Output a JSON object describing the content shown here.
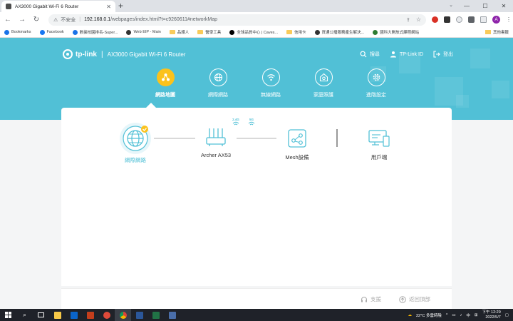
{
  "browser": {
    "tab_title": "AX3000 Gigabit Wi-Fi 6 Router",
    "address_insecure": "不安全",
    "address_host": "192.168.0.1",
    "address_path": "/webpages/index.html?t=c9260611#networkMap",
    "avatar_letter": "A",
    "bookmarks": [
      {
        "label": "Bookmarks",
        "icon": "star-icon",
        "color": "#1a73e8"
      },
      {
        "label": "Facebook",
        "icon": "facebook-icon",
        "color": "#1877f2"
      },
      {
        "label": "數據校園排名-Super...",
        "icon": "globe-icon",
        "color": "#1a73e8"
      },
      {
        "label": "Web EIP - Main",
        "icon": "globe-icon",
        "color": "#333333"
      },
      {
        "label": "品護人",
        "icon": "folder-icon",
        "color": "#f9cb5b"
      },
      {
        "label": "醫學工具",
        "icon": "folder-icon",
        "color": "#f9cb5b"
      },
      {
        "label": "全球品質中心 | Caves...",
        "icon": "wix-icon",
        "color": "#000000"
      },
      {
        "label": "信用卡",
        "icon": "folder-icon",
        "color": "#f9cb5b"
      },
      {
        "label": "資通公播服務產生解決...",
        "icon": "globe-icon",
        "color": "#333333"
      },
      {
        "label": "國科大開放式課程網站",
        "icon": "globe-icon",
        "color": "#2e7d32"
      }
    ],
    "other_bookmarks": "其他書籤"
  },
  "router": {
    "brand": "tp-link",
    "model": "AX3000 Gigabit Wi-Fi 6 Router",
    "header_actions": [
      {
        "label": "搜尋",
        "icon": "search-icon"
      },
      {
        "label": "TP-Link ID",
        "icon": "user-icon"
      },
      {
        "label": "登出",
        "icon": "logout-icon"
      }
    ],
    "nav": [
      {
        "label": "網路地圖",
        "icon": "network-map-icon",
        "active": true
      },
      {
        "label": "網際網路",
        "icon": "globe-icon",
        "active": false
      },
      {
        "label": "無線網路",
        "icon": "wifi-icon",
        "active": false
      },
      {
        "label": "家庭照護",
        "icon": "home-shield-icon",
        "active": false
      },
      {
        "label": "進階設定",
        "icon": "gear-icon",
        "active": false
      }
    ],
    "topology": {
      "internet_label": "網際網路",
      "router_label": "Archer AX53",
      "band_24": "2.4G",
      "band_5": "5G",
      "mesh_label": "Mesh設備",
      "clients_label": "用戶端"
    },
    "footer": {
      "support": "支援",
      "back_to_top": "返回頂部"
    },
    "colors": {
      "accent": "#51c0d6",
      "active_nav": "#fbc21c"
    }
  },
  "taskbar": {
    "weather": "22°C 多雲時陰",
    "ime": "中",
    "time": "下午 12:29",
    "date": "2022/5/7"
  }
}
